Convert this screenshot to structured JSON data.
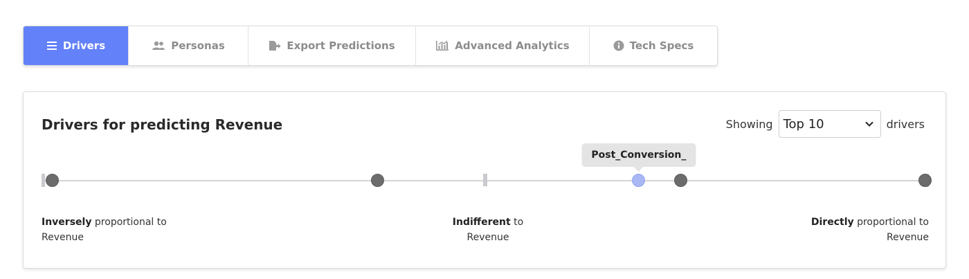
{
  "tabs": [
    {
      "label": "Drivers",
      "icon": "list-icon",
      "active": true
    },
    {
      "label": "Personas",
      "icon": "users-icon",
      "active": false
    },
    {
      "label": "Export Predictions",
      "icon": "file-export-icon",
      "active": false
    },
    {
      "label": "Advanced Analytics",
      "icon": "chart-icon",
      "active": false
    },
    {
      "label": "Tech Specs",
      "icon": "info-circle-icon",
      "active": false
    }
  ],
  "card": {
    "title": "Drivers for predicting Revenue",
    "showing_prefix": "Showing",
    "showing_suffix": "drivers",
    "select_value": "Top 10"
  },
  "slider": {
    "tooltip": "Post_Conversion_",
    "drivers": [
      {
        "position": 0.0,
        "highlighted": false
      },
      {
        "position": 0.373,
        "highlighted": false
      },
      {
        "position": 0.672,
        "highlighted": true
      },
      {
        "position": 0.72,
        "highlighted": false
      },
      {
        "position": 1.0,
        "highlighted": false
      }
    ]
  },
  "scale": {
    "left_bold": "Inversely",
    "left_rest": " proportional to",
    "left_line2": "Revenue",
    "mid_bold": "Indifferent",
    "mid_rest": " to",
    "mid_line2": "Revenue",
    "right_bold": "Directly",
    "right_rest": " proportional to",
    "right_line2": "Revenue"
  },
  "colors": {
    "accent": "#6381f8",
    "dot": "#6c6c6c",
    "highlight_dot": "#a9b8f5"
  }
}
